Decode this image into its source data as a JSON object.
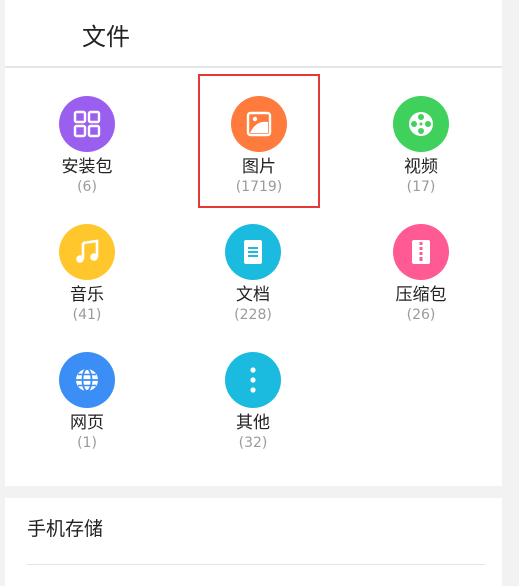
{
  "header": {
    "title": "文件"
  },
  "categories": [
    {
      "label": "安装包",
      "count": "(6)",
      "color": "#9b5ff0",
      "icon": "apps-grid-icon"
    },
    {
      "label": "图片",
      "count": "(1719)",
      "color": "#ff7a3d",
      "icon": "image-icon"
    },
    {
      "label": "视频",
      "count": "(17)",
      "color": "#3fd15c",
      "icon": "film-reel-icon"
    },
    {
      "label": "音乐",
      "count": "(41)",
      "color": "#ffc72c",
      "icon": "music-note-icon"
    },
    {
      "label": "文档",
      "count": "(228)",
      "color": "#1bbbe0",
      "icon": "document-icon"
    },
    {
      "label": "压缩包",
      "count": "(26)",
      "color": "#ff5a93",
      "icon": "zip-icon"
    },
    {
      "label": "网页",
      "count": "(1)",
      "color": "#3a8ef6",
      "icon": "globe-icon"
    },
    {
      "label": "其他",
      "count": "(32)",
      "color": "#1bbbe0",
      "icon": "more-vertical-icon"
    }
  ],
  "storage": {
    "label": "手机存储"
  },
  "colors": {
    "highlight": "#e53935"
  }
}
